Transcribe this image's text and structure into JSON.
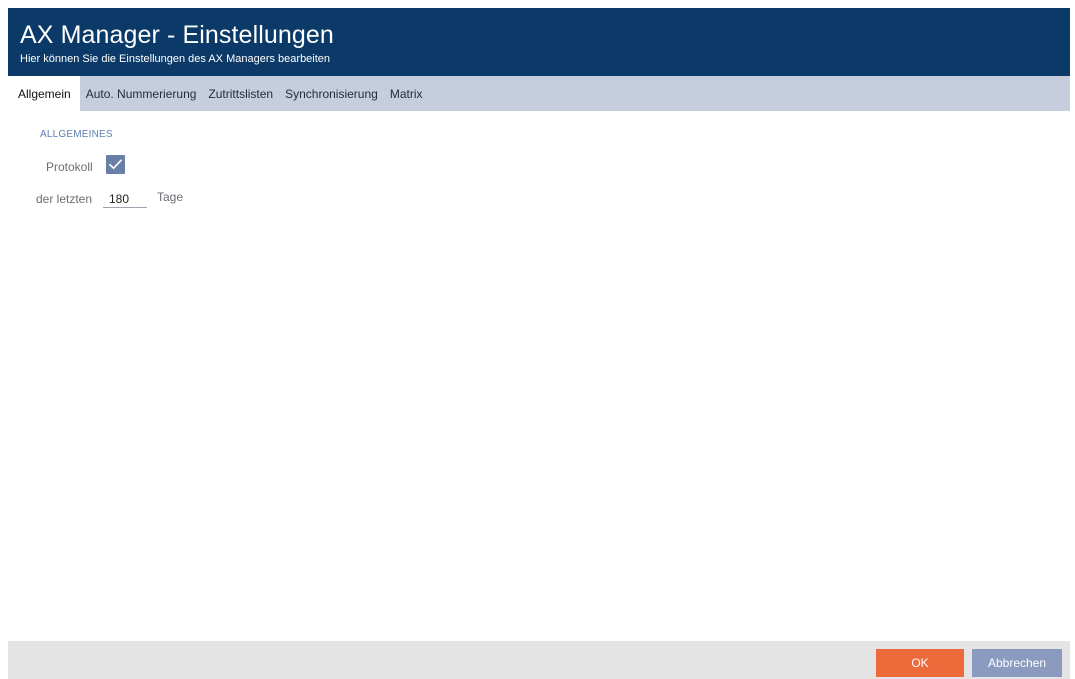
{
  "header": {
    "title": "AX Manager - Einstellungen",
    "subtitle": "Hier können Sie die Einstellungen des AX Managers bearbeiten"
  },
  "tabs": [
    {
      "label": "Allgemein",
      "active": true
    },
    {
      "label": "Auto. Nummerierung",
      "active": false
    },
    {
      "label": "Zutrittslisten",
      "active": false
    },
    {
      "label": "Synchronisierung",
      "active": false
    },
    {
      "label": "Matrix",
      "active": false
    }
  ],
  "general": {
    "section_title": "ALLGEMEINES",
    "protokoll_label": "Protokoll",
    "protokoll_checked": true,
    "days_prefix_label": "der letzten",
    "days_value": "180",
    "days_suffix_label": "Tage"
  },
  "footer": {
    "ok_label": "OK",
    "cancel_label": "Abbrechen"
  },
  "colors": {
    "header_bg": "#0b3a68",
    "tabbar_bg": "#c6cede",
    "checkbox": "#6a7fa7",
    "ok_button": "#ed6a3a",
    "cancel_button": "#8a9bbf",
    "section_title": "#5a7fb0"
  },
  "icons": {
    "checkbox_mark": "checkmark-icon"
  }
}
